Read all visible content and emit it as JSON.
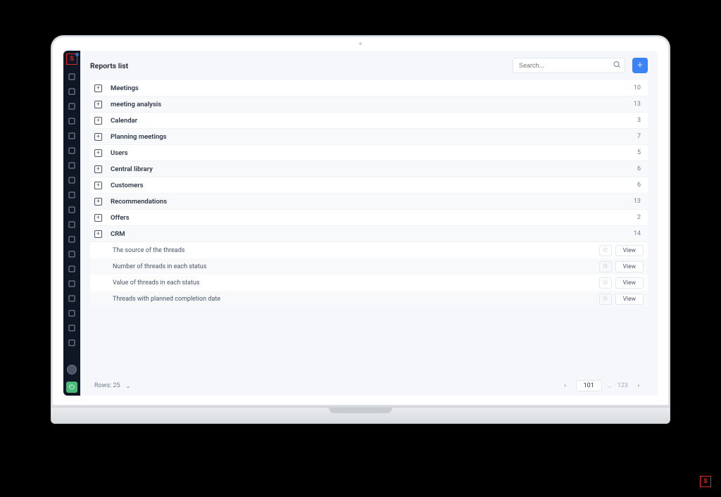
{
  "page": {
    "title": "Reports list",
    "search_placeholder": "Search..."
  },
  "categories": [
    {
      "label": "Meetings",
      "count": 10
    },
    {
      "label": "meeting analysis",
      "count": 13
    },
    {
      "label": "Calendar",
      "count": 3
    },
    {
      "label": "Planning meetings",
      "count": 7
    },
    {
      "label": "Users",
      "count": 5
    },
    {
      "label": "Central library",
      "count": 6
    },
    {
      "label": "Customers",
      "count": 6
    },
    {
      "label": "Recommendations",
      "count": 13
    },
    {
      "label": "Offers",
      "count": 2
    },
    {
      "label": "CRM",
      "count": 14
    }
  ],
  "crm_children": [
    {
      "label": "The source of the threads"
    },
    {
      "label": "Number of threads in each status"
    },
    {
      "label": "Value of threads in each status"
    },
    {
      "label": "Threads with planned completion date"
    }
  ],
  "buttons": {
    "view": "View"
  },
  "footer": {
    "rows_label": "Rows: 25",
    "current_page": "101",
    "last_page": "123",
    "ellipsis": "…"
  },
  "sidebar_icons": [
    "globe-icon",
    "chart-icon",
    "dashboard-icon",
    "page-icon",
    "database-icon",
    "list-icon",
    "briefcase-icon",
    "folder-icon",
    "card-icon",
    "grid-icon",
    "cloud-icon",
    "send-icon",
    "cube-icon",
    "layers-icon",
    "bell-icon",
    "tag-icon",
    "building-icon",
    "people-icon",
    "gear-icon"
  ]
}
